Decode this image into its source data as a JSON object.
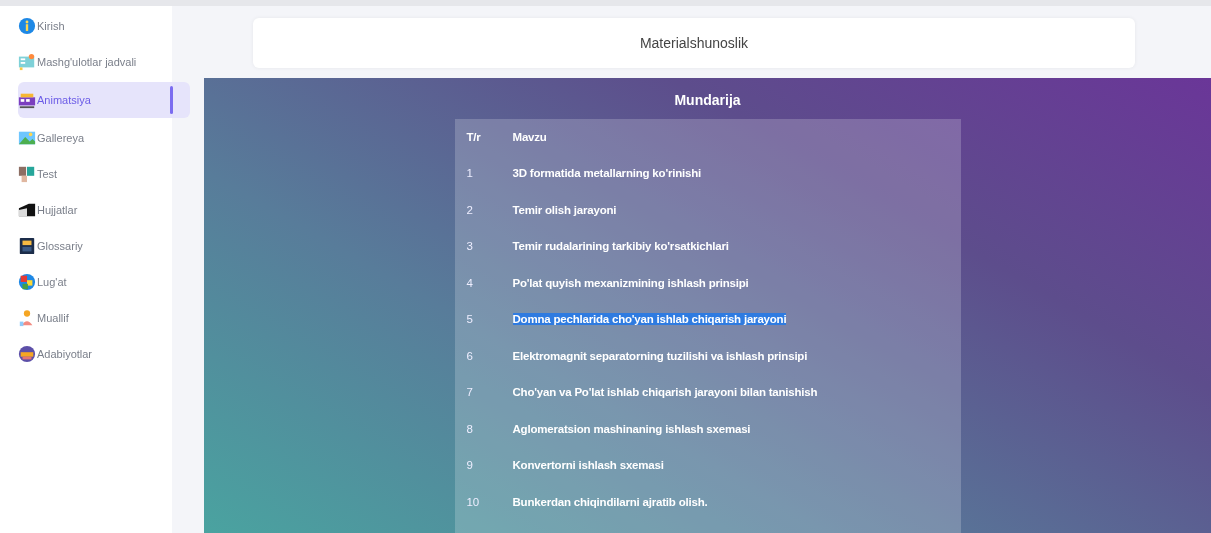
{
  "sidebar": {
    "items": [
      {
        "label": "Kirish",
        "selected": false
      },
      {
        "label": "Mashg'ulotlar jadvali",
        "selected": false
      },
      {
        "label": "Animatsiya",
        "selected": true
      },
      {
        "label": "Gallereya",
        "selected": false
      },
      {
        "label": "Test",
        "selected": false
      },
      {
        "label": "Hujjatlar",
        "selected": false
      },
      {
        "label": "Glossariy",
        "selected": false
      },
      {
        "label": "Lug'at",
        "selected": false
      },
      {
        "label": "Muallif",
        "selected": false
      },
      {
        "label": "Adabiyotlar",
        "selected": false
      }
    ]
  },
  "header": {
    "title": "Materialshunoslik"
  },
  "contents": {
    "title": "Mundarija",
    "columns": [
      "T/r",
      "Mavzu"
    ],
    "rows": [
      {
        "number": "1",
        "topic": "3D formatida metallarning ko'rinishi",
        "selected": false
      },
      {
        "number": "2",
        "topic": "Temir olish jarayoni",
        "selected": false
      },
      {
        "number": "3",
        "topic": "Temir rudalarining tarkibiy ko'rsatkichlari",
        "selected": false
      },
      {
        "number": "4",
        "topic": "Po'lat quyish mexanizmining ishlash prinsipi",
        "selected": false
      },
      {
        "number": "5",
        "topic": "Domna pechlarida cho'yan ishlab chiqarish jarayoni",
        "selected": true
      },
      {
        "number": "6",
        "topic": "Elektromagnit separatorning tuzilishi va ishlash prinsipi",
        "selected": false
      },
      {
        "number": "7",
        "topic": "Cho'yan va Po'lat ishlab chiqarish jarayoni bilan tanishish",
        "selected": false
      },
      {
        "number": "8",
        "topic": "Aglomeratsion mashinaning ishlash sxemasi",
        "selected": false
      },
      {
        "number": "9",
        "topic": "Konvertorni ishlash sxemasi",
        "selected": false
      },
      {
        "number": "10",
        "topic": "Bunkerdan chiqindilarni ajratib olish.",
        "selected": false
      }
    ]
  }
}
